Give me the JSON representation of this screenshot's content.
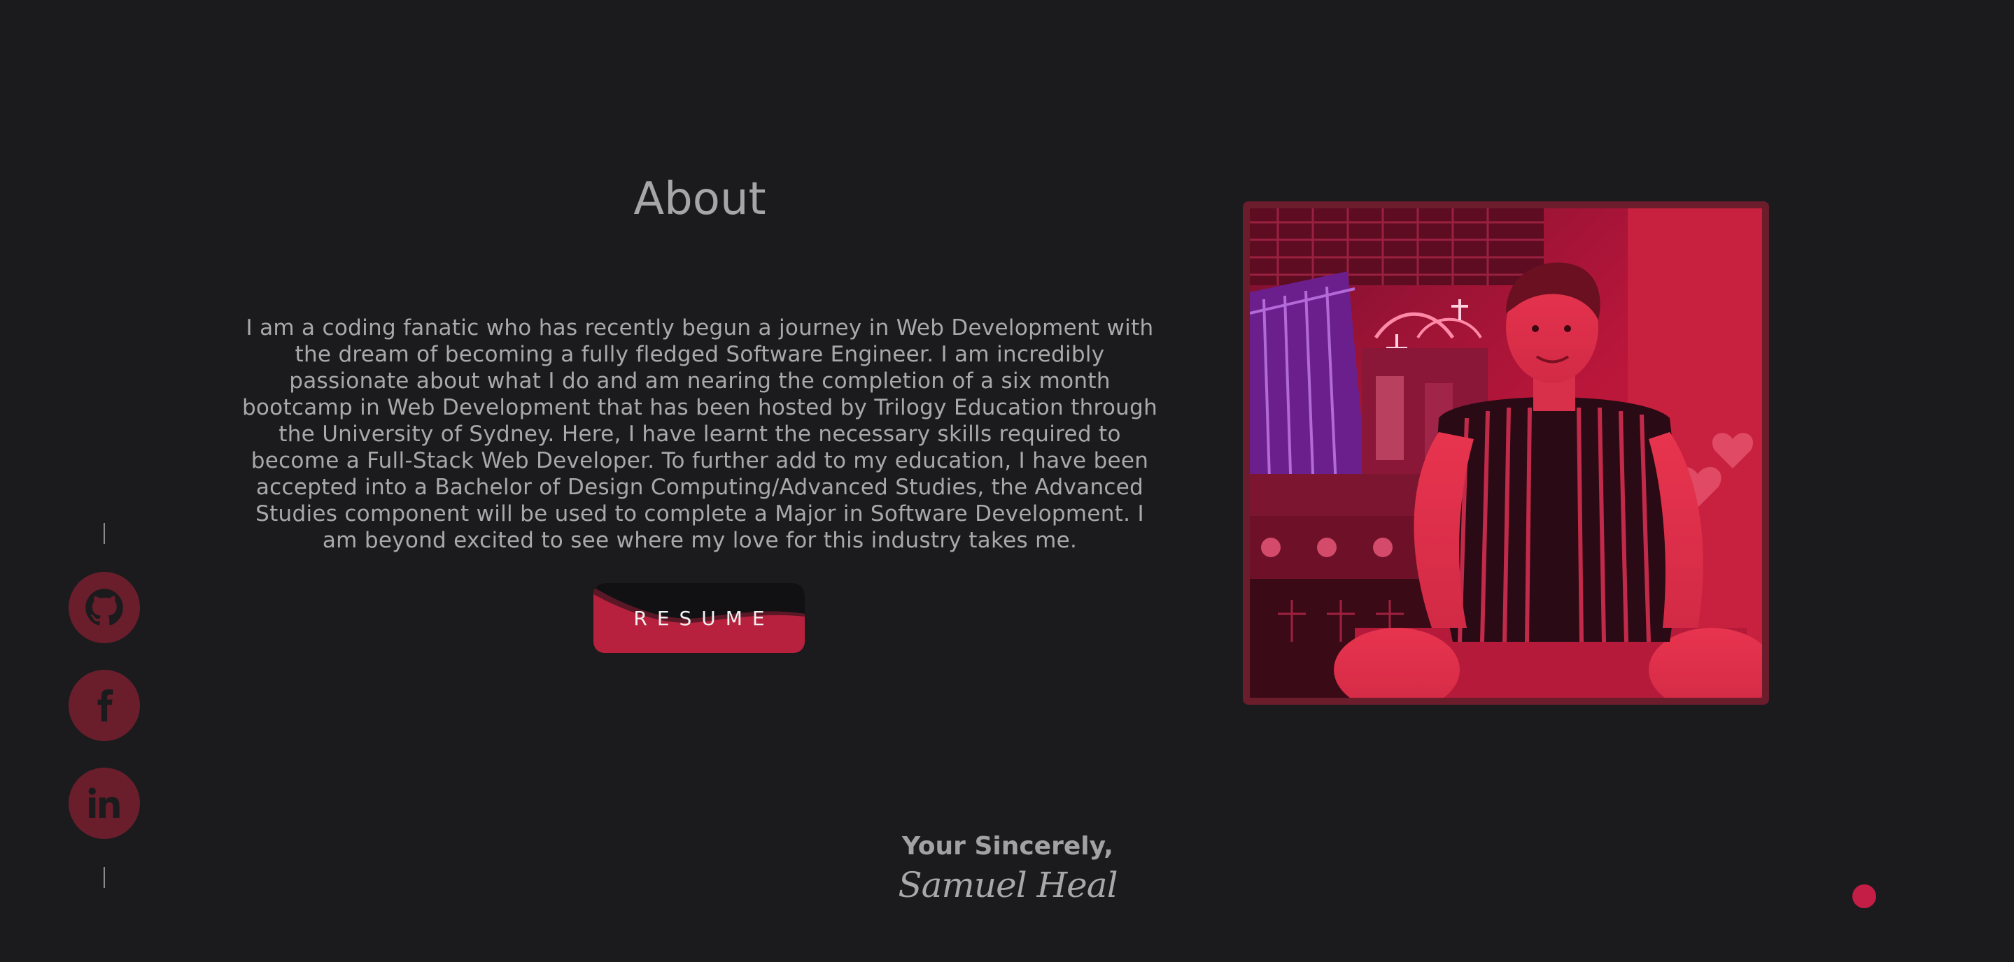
{
  "about": {
    "title": "About",
    "text": "I am a coding fanatic who has recently begun a journey in Web Development with the dream of becoming a fully fledged Software Engineer. I am incredibly passionate about what I do and am nearing the completion of a six month bootcamp in Web Development that has been hosted by Trilogy Education through the University of Sydney. Here, I have learnt the necessary skills required to become a Full-Stack Web Developer. To further add to my education, I have been accepted into a Bachelor of Design Computing/Advanced Studies, the Advanced Studies component will be used to complete a Major in Software Development. I am beyond excited to see where my love for this industry takes me.",
    "resume_label": "RESUME"
  },
  "social": {
    "items": [
      {
        "icon": "github-icon"
      },
      {
        "icon": "facebook-icon"
      },
      {
        "icon": "linkedin-icon"
      }
    ]
  },
  "signoff": {
    "closing": "Your Sincerely,",
    "signature": "Samuel Heal"
  },
  "colors": {
    "background": "#1b1b1d",
    "accent": "#c41e46",
    "social_bg": "#6a1e2c",
    "frame": "#6b1d2c"
  }
}
